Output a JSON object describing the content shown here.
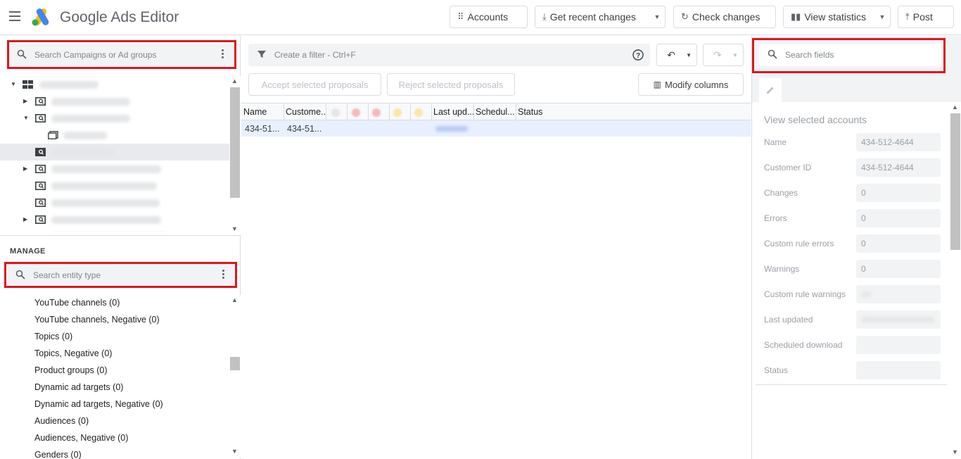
{
  "app": {
    "title": "Google Ads Editor"
  },
  "toolbar": {
    "accounts": "Accounts",
    "get_recent_changes": "Get recent changes",
    "check_changes": "Check changes",
    "view_statistics": "View statistics",
    "post": "Post"
  },
  "left_panel": {
    "search_placeholder": "Search Campaigns or Ad groups",
    "manage_label": "MANAGE",
    "entity_search_placeholder": "Search entity type",
    "entity_types": [
      "YouTube channels (0)",
      "YouTube channels, Negative (0)",
      "Topics (0)",
      "Topics, Negative (0)",
      "Product groups (0)",
      "Dynamic ad targets (0)",
      "Dynamic ad targets, Negative (0)",
      "Audiences (0)",
      "Audiences, Negative (0)",
      "Genders (0)"
    ]
  },
  "center": {
    "filter_placeholder": "Create a filter - Ctrl+F",
    "accept_button": "Accept selected proposals",
    "reject_button": "Reject selected proposals",
    "modify_columns": "Modify columns",
    "columns": [
      "Name",
      "Custome...",
      "Last upd...",
      "Schedul...",
      "Status"
    ],
    "rows": [
      {
        "name": "434-51...",
        "customer": "434-51..."
      }
    ]
  },
  "right_panel": {
    "search_placeholder": "Search fields",
    "title": "View selected accounts",
    "fields": [
      {
        "label": "Name",
        "value": "434-512-4644"
      },
      {
        "label": "Customer ID",
        "value": "434-512-4644"
      },
      {
        "label": "Changes",
        "value": "0"
      },
      {
        "label": "Errors",
        "value": "0"
      },
      {
        "label": "Custom rule errors",
        "value": "0"
      },
      {
        "label": "Warnings",
        "value": "0"
      },
      {
        "label": "Custom rule warnings",
        "value": ""
      },
      {
        "label": "Last updated",
        "value": ""
      },
      {
        "label": "Scheduled download",
        "value": ""
      },
      {
        "label": "Status",
        "value": ""
      }
    ]
  },
  "colors": {
    "highlight_red": "#e0141e",
    "selection_blue": "#e8f0fe"
  }
}
